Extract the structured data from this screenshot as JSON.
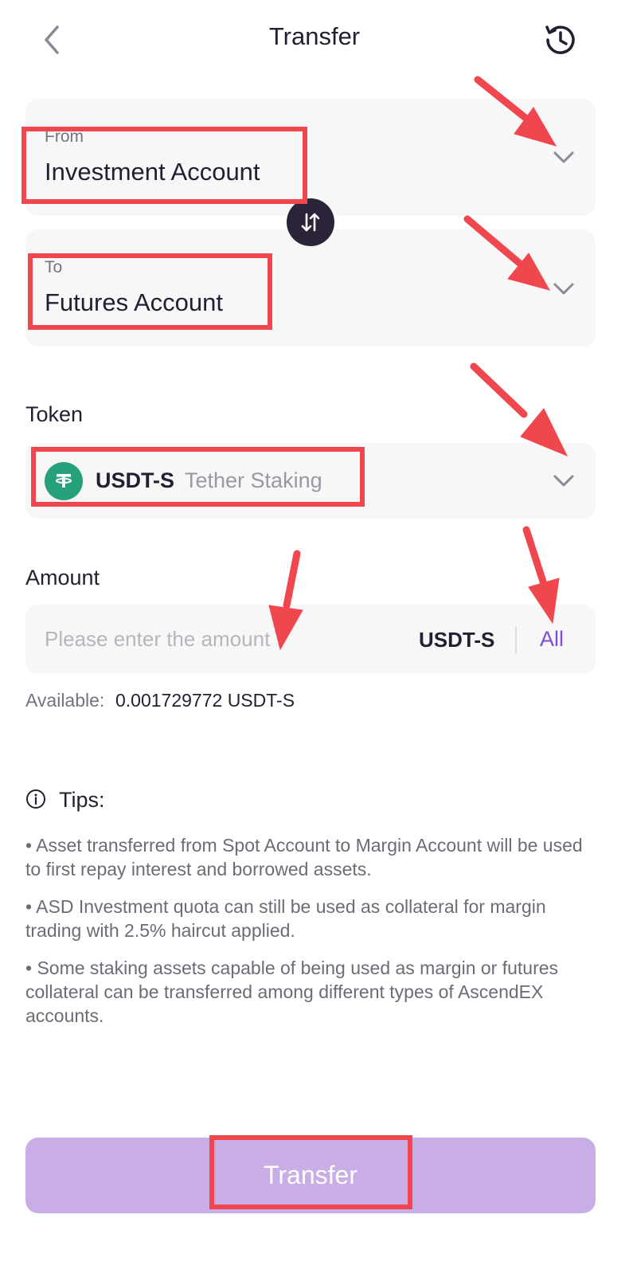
{
  "header": {
    "title": "Transfer"
  },
  "from": {
    "label": "From",
    "value": "Investment Account"
  },
  "to": {
    "label": "To",
    "value": "Futures Account"
  },
  "token": {
    "section_label": "Token",
    "symbol": "USDT-S",
    "name": "Tether Staking"
  },
  "amount": {
    "section_label": "Amount",
    "placeholder": "Please enter the amount",
    "unit": "USDT-S",
    "all_label": "All",
    "available_label": "Available:",
    "available_value": "0.001729772 USDT-S"
  },
  "tips": {
    "title": "Tips:",
    "items": [
      "• Asset transferred from Spot Account to Margin Account will be used to first repay interest and borrowed assets.",
      "• ASD Investment quota can still be used as collateral for margin trading with 2.5% haircut applied.",
      "• Some staking assets capable of being used as margin or futures collateral can be transferred among different types of AscendEX accounts."
    ]
  },
  "submit": {
    "label": "Transfer"
  },
  "colors": {
    "accent": "#7b4fd6",
    "button_disabled": "#c9aee6",
    "token_brand": "#26a17b",
    "annotation": "#f0474f"
  },
  "icons": [
    "back-arrow-icon",
    "history-clock-icon",
    "chevron-down-icon",
    "swap-arrows-icon",
    "tether-logo-icon",
    "info-circle-icon"
  ]
}
